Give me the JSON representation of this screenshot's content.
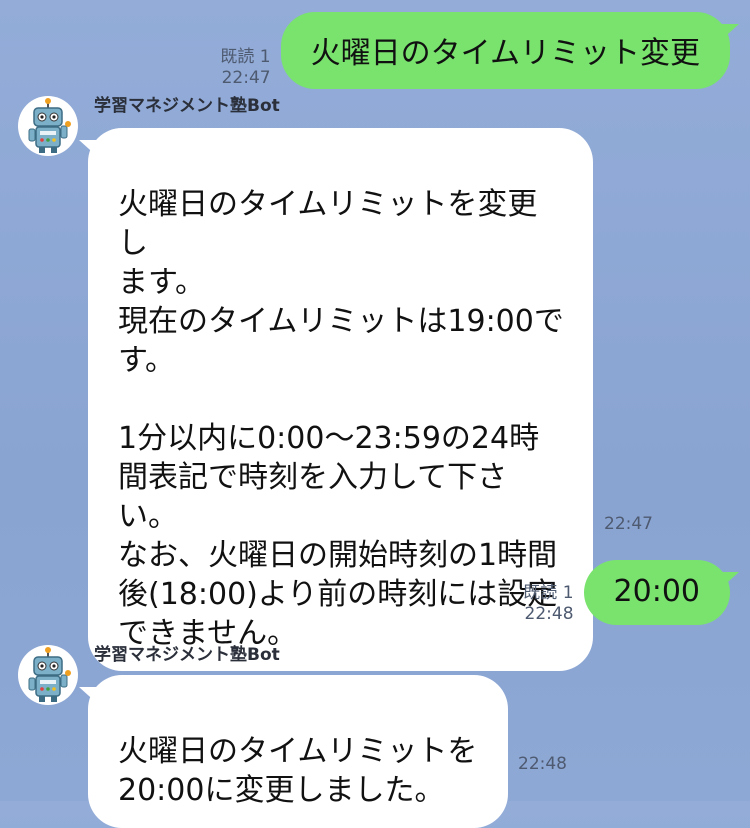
{
  "chat": {
    "msg1": {
      "read": "既読 1",
      "time": "22:47",
      "text": "火曜日のタイムリミット変更"
    },
    "reply1": {
      "sender": "学習マネジメント塾Bot",
      "text": "火曜日のタイムリミットを変更し\nます。\n現在のタイムリミットは19:00で\nす。\n\n1分以内に0:00〜23:59の24時\n間表記で時刻を入力して下さい。\nなお、火曜日の開始時刻の1時間\n後(18:00)より前の時刻には設定\nできません。",
      "time": "22:47"
    },
    "msg2": {
      "read": "既読 1",
      "time": "22:48",
      "text": "20:00"
    },
    "reply2": {
      "sender": "学習マネジメント塾Bot",
      "text": "火曜日のタイムリミットを\n20:00に変更しました。",
      "time": "22:48"
    },
    "avatar_icon": "robot-icon",
    "colors": {
      "background": "#8fa8d4",
      "outgoing_bubble": "#79e36e",
      "incoming_bubble": "#ffffff"
    }
  }
}
